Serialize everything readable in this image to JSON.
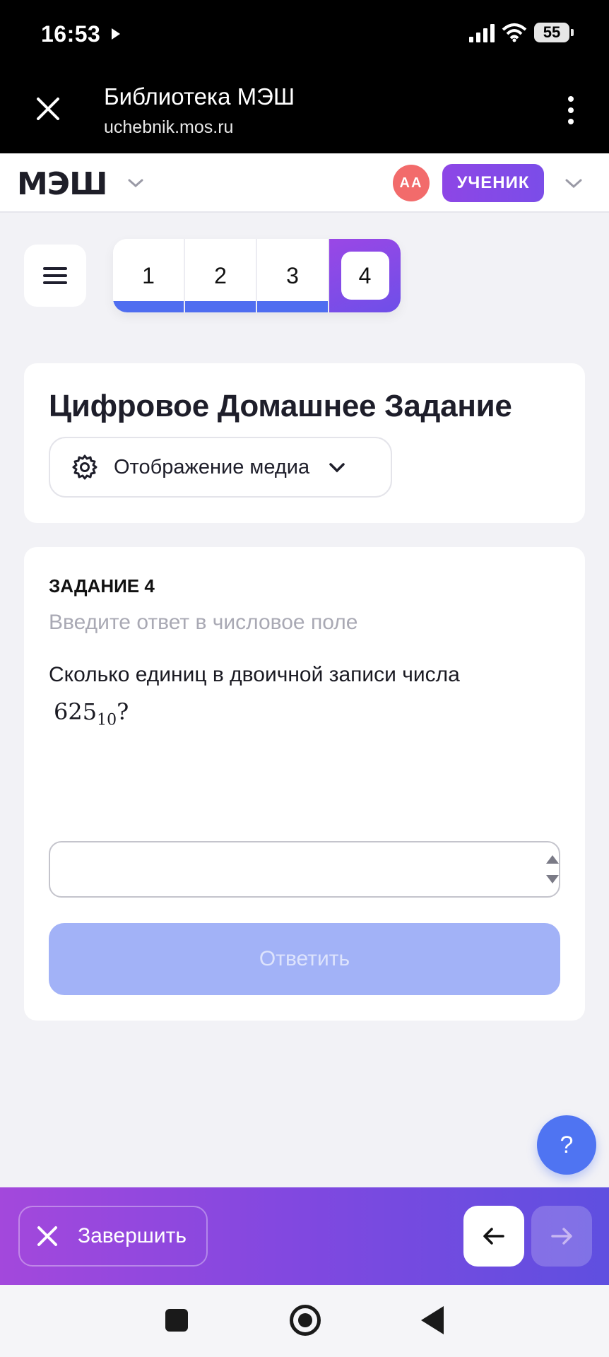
{
  "status_bar": {
    "time": "16:53",
    "battery": "55"
  },
  "browser": {
    "title": "Библиотека МЭШ",
    "url": "uchebnik.mos.ru"
  },
  "header": {
    "logo": "МЭШ",
    "avatar_initials": "АА",
    "role": "УЧЕНИК"
  },
  "task_nav": {
    "tabs": [
      {
        "label": "1",
        "completed": true
      },
      {
        "label": "2",
        "completed": true
      },
      {
        "label": "3",
        "completed": true
      },
      {
        "label": "4",
        "completed": false,
        "active": true
      }
    ]
  },
  "page": {
    "title": "Цифровое Домашнее Задание",
    "media_button": "Отображение медиа"
  },
  "task": {
    "label": "ЗАДАНИЕ 4",
    "hint": "Введите ответ в числовое поле",
    "question": "Сколько единиц в двоичной записи числа",
    "math_number": "625",
    "math_base": "10",
    "math_suffix": "?",
    "input_value": "",
    "submit_label": "Ответить"
  },
  "help": {
    "label": "?"
  },
  "action_bar": {
    "finish_label": "Завершить"
  },
  "colors": {
    "accent_blue": "#4f6df0",
    "accent_purple": "#8d46e6",
    "avatar": "#f26b6b",
    "submit_disabled": "#a2b2f7"
  }
}
